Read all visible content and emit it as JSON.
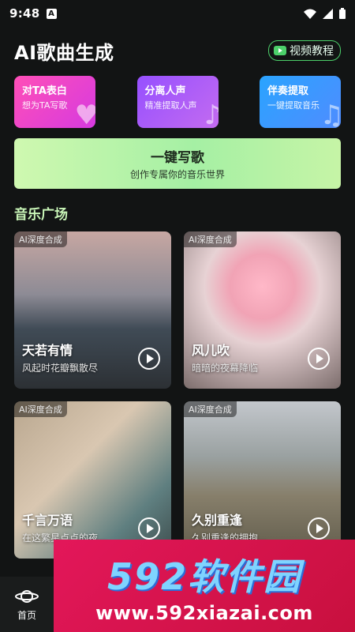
{
  "status": {
    "time": "9:48",
    "a_badge": "A"
  },
  "header": {
    "title": "AI歌曲生成",
    "video_btn": "视频教程"
  },
  "features": [
    {
      "title": "对TA表白",
      "sub": "想为TA写歌"
    },
    {
      "title": "分离人声",
      "sub": "精准提取人声"
    },
    {
      "title": "伴奏提取",
      "sub": "一键提取音乐"
    }
  ],
  "compose": {
    "title": "一键写歌",
    "sub": "创作专属你的音乐世界"
  },
  "section": {
    "title": "音乐广场"
  },
  "songs": [
    {
      "badge": "AI深度合成",
      "title": "天若有情",
      "sub": "风起时花瓣飘散尽"
    },
    {
      "badge": "AI深度合成",
      "title": "风儿吹",
      "sub": "暗暗的夜幕降临"
    },
    {
      "badge": "AI深度合成",
      "title": "千言万语",
      "sub": "在这繁星点点的夜..."
    },
    {
      "badge": "AI深度合成",
      "title": "久别重逢",
      "sub": "久别重逢的拥抱..."
    }
  ],
  "nav": {
    "home_label": "首页"
  },
  "watermark": {
    "big": "592软件园",
    "small": "www.592xiazai.com"
  },
  "colors": {
    "accent_green": "#4cd06a",
    "section_title": "#c9f6b8"
  }
}
